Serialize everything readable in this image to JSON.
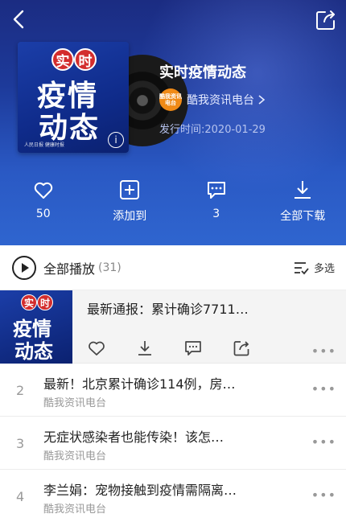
{
  "header": {
    "album_title": "实时疫情动态",
    "artist": {
      "name": "酷我资讯电台",
      "avatar_text": "酷我资讯电台"
    },
    "release_label": "发行时间:2020-01-29",
    "cover": {
      "badge1": "实",
      "badge2": "时",
      "line1": "疫情",
      "line2": "动态",
      "logo_text": "人民日报 健康时报"
    },
    "actions": [
      {
        "label": "50",
        "icon": "heart-icon"
      },
      {
        "label": "添加到",
        "icon": "add-box-icon"
      },
      {
        "label": "3",
        "icon": "comment-icon"
      },
      {
        "label": "全部下载",
        "icon": "download-icon"
      }
    ]
  },
  "playbar": {
    "label": "全部播放",
    "count": "(31)",
    "multi_label": "多选"
  },
  "tracks": [
    {
      "title": "最新通报：累计确诊7711…",
      "artist": ""
    },
    {
      "num": "2",
      "title": "最新！北京累计确诊114例，房…",
      "artist": "酷我资讯电台"
    },
    {
      "num": "3",
      "title": "无症状感染者也能传染！该怎…",
      "artist": "酷我资讯电台"
    },
    {
      "num": "4",
      "title": "李兰娟：宠物接触到疫情需隔离…",
      "artist": "酷我资讯电台"
    }
  ],
  "colors": {
    "header_bg": "#1d3a9a",
    "accent_orange": "#f08a16",
    "badge_red": "#d32d2d"
  }
}
